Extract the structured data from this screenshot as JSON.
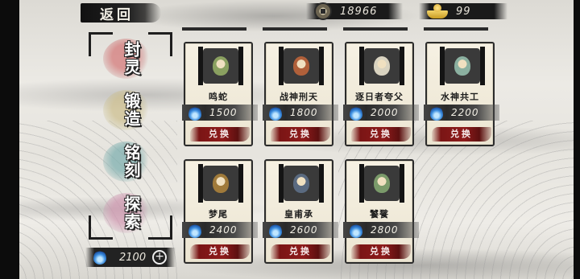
{
  "header": {
    "back_label": "返回",
    "copper_coins": "18966",
    "gold_ingots": "99"
  },
  "menu": [
    {
      "label": "封灵",
      "color": "red"
    },
    {
      "label": "锻造",
      "color": "tan"
    },
    {
      "label": "铭刻",
      "color": "teal"
    },
    {
      "label": "探索",
      "color": "pink"
    }
  ],
  "soul_currency": {
    "value": "2100",
    "plus_label": "+"
  },
  "cards": [
    {
      "name": "鸣蛇",
      "price": "1500",
      "button": "兑换",
      "portrait": "green-hooded-figure",
      "tint": "#8aa060"
    },
    {
      "name": "战神刑天",
      "price": "1800",
      "button": "兑换",
      "portrait": "bearded-warrior",
      "tint": "#b0603a"
    },
    {
      "name": "逐日者夸父",
      "price": "2000",
      "button": "兑换",
      "portrait": "white-haired-elder",
      "tint": "#d9d3c0"
    },
    {
      "name": "水神共工",
      "price": "2200",
      "button": "兑换",
      "portrait": "horned-water-god",
      "tint": "#8bb0a0"
    },
    {
      "name": "梦尾",
      "price": "2400",
      "button": "兑换",
      "portrait": "bird-creature",
      "tint": "#a07a3a"
    },
    {
      "name": "皇甫承",
      "price": "2600",
      "button": "兑换",
      "portrait": "armored-general",
      "tint": "#5a6a80"
    },
    {
      "name": "饕餮",
      "price": "2800",
      "button": "兑换",
      "portrait": "beast-mask",
      "tint": "#7a9a6a"
    }
  ]
}
